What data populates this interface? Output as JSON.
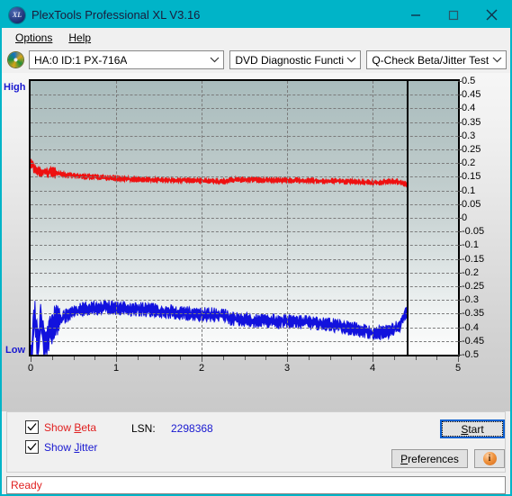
{
  "window": {
    "title": "PlexTools Professional XL V3.16",
    "icon": "XL",
    "accent_color": "#00b4c8",
    "buttons": [
      {
        "name": "minimize",
        "glyph": "minimize-icon"
      },
      {
        "name": "maximize",
        "glyph": "maximize-icon"
      },
      {
        "name": "close",
        "glyph": "close-icon"
      }
    ]
  },
  "menubar": {
    "items": [
      {
        "label": "Options",
        "accel": "O"
      },
      {
        "label": "Help",
        "accel": "H"
      }
    ]
  },
  "toolbar": {
    "drive_icon": "optical-disc-icon",
    "drive": "HA:0 ID:1  PX-716A",
    "function": "DVD Diagnostic Functions",
    "test": "Q-Check Beta/Jitter Test"
  },
  "chart_data": {
    "type": "line",
    "title": "Q-Check Beta/Jitter Test",
    "xlabel": "",
    "ylabel": "",
    "xlim": [
      0,
      5
    ],
    "ylim": [
      -0.5,
      0.5
    ],
    "grid": true,
    "legend_position": "bottom-left",
    "axis_left_top_label": "High",
    "axis_left_bottom_label": "Low",
    "xticks": [
      0,
      1,
      2,
      3,
      4,
      5
    ],
    "yticks": [
      0.5,
      0.45,
      0.4,
      0.35,
      0.3,
      0.25,
      0.2,
      0.15,
      0.1,
      0.05,
      0,
      -0.05,
      -0.1,
      -0.15,
      -0.2,
      -0.25,
      -0.3,
      -0.35,
      -0.4,
      -0.45,
      -0.5
    ],
    "ytick_labels": [
      "0.5",
      "0.45",
      "0.4",
      "0.35",
      "0.3",
      "0.25",
      "0.2",
      "0.15",
      "0.1",
      "0.05",
      "0",
      "-0.05",
      "-0.1",
      "-0.15",
      "-0.2",
      "-0.25",
      "-0.3",
      "-0.35",
      "-0.4",
      "-0.45",
      "-0.5"
    ],
    "data_end_x": 4.4,
    "series": [
      {
        "name": "Beta",
        "color": "#ee1111",
        "x": [
          0.02,
          0.05,
          0.08,
          0.12,
          0.16,
          0.2,
          0.25,
          0.3,
          0.35,
          0.42,
          0.5,
          0.6,
          0.7,
          0.8,
          0.9,
          1.0,
          1.15,
          1.3,
          1.45,
          1.6,
          1.75,
          1.9,
          2.05,
          2.2,
          2.3,
          2.35,
          2.5,
          2.65,
          2.8,
          2.95,
          3.1,
          3.25,
          3.4,
          3.55,
          3.7,
          3.85,
          4.0,
          4.1,
          4.15,
          4.25,
          4.35,
          4.4
        ],
        "y": [
          0.195,
          0.175,
          0.172,
          0.168,
          0.17,
          0.165,
          0.168,
          0.163,
          0.16,
          0.157,
          0.155,
          0.152,
          0.15,
          0.148,
          0.146,
          0.144,
          0.142,
          0.14,
          0.139,
          0.138,
          0.137,
          0.136,
          0.135,
          0.134,
          0.134,
          0.14,
          0.139,
          0.139,
          0.138,
          0.137,
          0.137,
          0.136,
          0.135,
          0.134,
          0.133,
          0.131,
          0.129,
          0.128,
          0.134,
          0.133,
          0.13,
          0.12
        ],
        "noise": 0.012
      },
      {
        "name": "Jitter",
        "color": "#1212dd",
        "x": [
          0.01,
          0.03,
          0.05,
          0.07,
          0.09,
          0.12,
          0.15,
          0.18,
          0.22,
          0.26,
          0.3,
          0.35,
          0.4,
          0.45,
          0.5,
          0.55,
          0.62,
          0.7,
          0.78,
          0.86,
          0.95,
          1.05,
          1.15,
          1.25,
          1.4,
          1.55,
          1.7,
          1.85,
          2.0,
          2.15,
          2.28,
          2.32,
          2.45,
          2.6,
          2.75,
          2.9,
          3.05,
          3.2,
          3.35,
          3.5,
          3.65,
          3.8,
          3.95,
          4.05,
          4.15,
          4.25,
          4.32,
          4.38,
          4.4
        ],
        "y": [
          -0.495,
          -0.42,
          -0.345,
          -0.43,
          -0.47,
          -0.36,
          -0.44,
          -0.48,
          -0.42,
          -0.395,
          -0.38,
          -0.37,
          -0.36,
          -0.352,
          -0.345,
          -0.34,
          -0.334,
          -0.33,
          -0.328,
          -0.327,
          -0.328,
          -0.33,
          -0.332,
          -0.334,
          -0.338,
          -0.342,
          -0.346,
          -0.35,
          -0.352,
          -0.354,
          -0.356,
          -0.37,
          -0.372,
          -0.374,
          -0.376,
          -0.378,
          -0.38,
          -0.382,
          -0.385,
          -0.39,
          -0.398,
          -0.408,
          -0.416,
          -0.42,
          -0.418,
          -0.41,
          -0.39,
          -0.355,
          -0.345
        ],
        "noise": 0.03
      }
    ]
  },
  "controls": {
    "show_beta": {
      "label_pre": "Show ",
      "label_accel": "B",
      "label_post": "eta",
      "checked": true
    },
    "show_jitter": {
      "label_pre": "Show ",
      "label_accel": "J",
      "label_post": "itter",
      "checked": true
    },
    "lsn_label": "LSN:",
    "lsn_value": "2298368",
    "start_button": {
      "pre": "",
      "accel": "S",
      "post": "tart"
    },
    "preferences_button": {
      "pre": "",
      "accel": "P",
      "post": "references"
    },
    "info_button": "info-icon"
  },
  "statusbar": {
    "text": "Ready"
  }
}
